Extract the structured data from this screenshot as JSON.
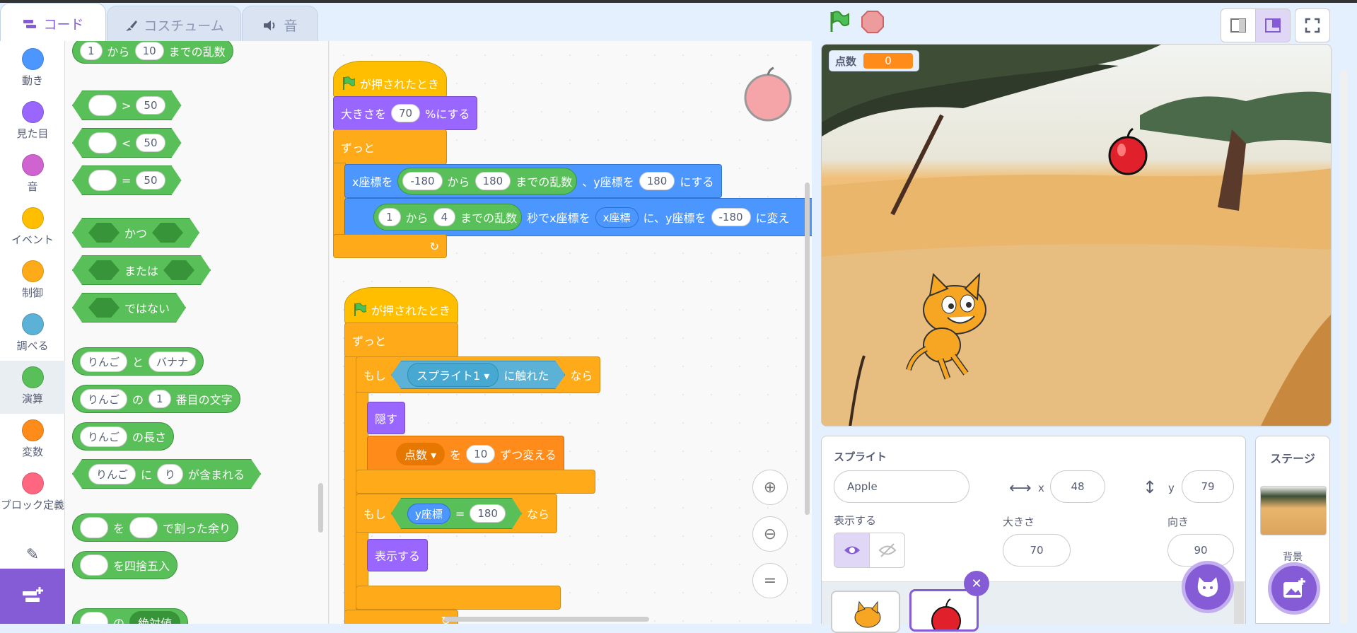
{
  "tabs": [
    {
      "label": "コード",
      "icon": "code-icon"
    },
    {
      "label": "コスチューム",
      "icon": "brush-icon"
    },
    {
      "label": "音",
      "icon": "speaker-icon"
    }
  ],
  "categories": [
    {
      "label": "動き",
      "color": "#4c97ff"
    },
    {
      "label": "見た目",
      "color": "#9966ff"
    },
    {
      "label": "音",
      "color": "#cf63cf"
    },
    {
      "label": "イベント",
      "color": "#ffbf00"
    },
    {
      "label": "制御",
      "color": "#ffab19"
    },
    {
      "label": "調べる",
      "color": "#5cb1d6"
    },
    {
      "label": "演算",
      "color": "#59c059"
    },
    {
      "label": "変数",
      "color": "#ff8c1a"
    },
    {
      "label": "ブロック定義",
      "color": "#ff6680"
    }
  ],
  "flyout": {
    "random": {
      "from": "1",
      "from_label": "から",
      "to": "10",
      "to_label": "までの乱数"
    },
    "gt": {
      "op": ">",
      "val": "50"
    },
    "lt": {
      "op": "<",
      "val": "50"
    },
    "eq": {
      "op": "=",
      "val": "50"
    },
    "and": "かつ",
    "or": "または",
    "not": "ではない",
    "join": {
      "a": "りんご",
      "op": "と",
      "b": "バナナ"
    },
    "letter": {
      "a": "りんご",
      "op": "の",
      "n": "1",
      "suffix": "番目の文字"
    },
    "length": {
      "a": "りんご",
      "suffix": "の長さ"
    },
    "contains": {
      "a": "りんご",
      "op": "に",
      "b": "り",
      "suffix": "が含まれる"
    },
    "mod": {
      "op1": "を",
      "op2": "で割った余り"
    },
    "round": "を四捨五入",
    "abs": {
      "op": "の",
      "fn": "絶対値"
    }
  },
  "script1": {
    "hat": "が押されたとき",
    "size": {
      "pre": "大きさを",
      "val": "70",
      "post": "%にする"
    },
    "forever": "ずっと",
    "goto": {
      "pre": "x座標を",
      "from": "-180",
      "from_label": "から",
      "to": "180",
      "to_label": "までの乱数",
      "mid": "、y座標を",
      "y": "180",
      "post": "にする"
    },
    "glide": {
      "from": "1",
      "from_label": "から",
      "to": "4",
      "to_label": "までの乱数",
      "mid1": "秒でx座標を",
      "x": "x座標",
      "mid2": "に、y座標を",
      "y": "-180",
      "post": "に変え"
    }
  },
  "script2": {
    "hat": "が押されたとき",
    "forever": "ずっと",
    "if1": {
      "pre": "もし",
      "target": "スプライト1",
      "cond": "に触れた",
      "post": "なら"
    },
    "hide": "隠す",
    "change": {
      "var": "点数",
      "pre": "を",
      "val": "10",
      "post": "ずつ変える"
    },
    "if2": {
      "pre": "もし",
      "lhs": "y座標",
      "op": "=",
      "rhs": "180",
      "post": "なら"
    },
    "show": "表示する"
  },
  "stage": {
    "monitor_label": "点数",
    "monitor_value": "0"
  },
  "sprite_info": {
    "label": "スプライト",
    "name": "Apple",
    "x_label": "x",
    "x": "48",
    "y_label": "y",
    "y": "79",
    "show_label": "表示する",
    "size_label": "大きさ",
    "size": "70",
    "direction_label": "向き",
    "direction": "90"
  },
  "stage_panel": {
    "title": "ステージ",
    "backdrops_label": "背景"
  },
  "colors": {
    "accent": "#855cd6",
    "operators": "#59c059",
    "control": "#ffab19",
    "events": "#ffbf00"
  }
}
